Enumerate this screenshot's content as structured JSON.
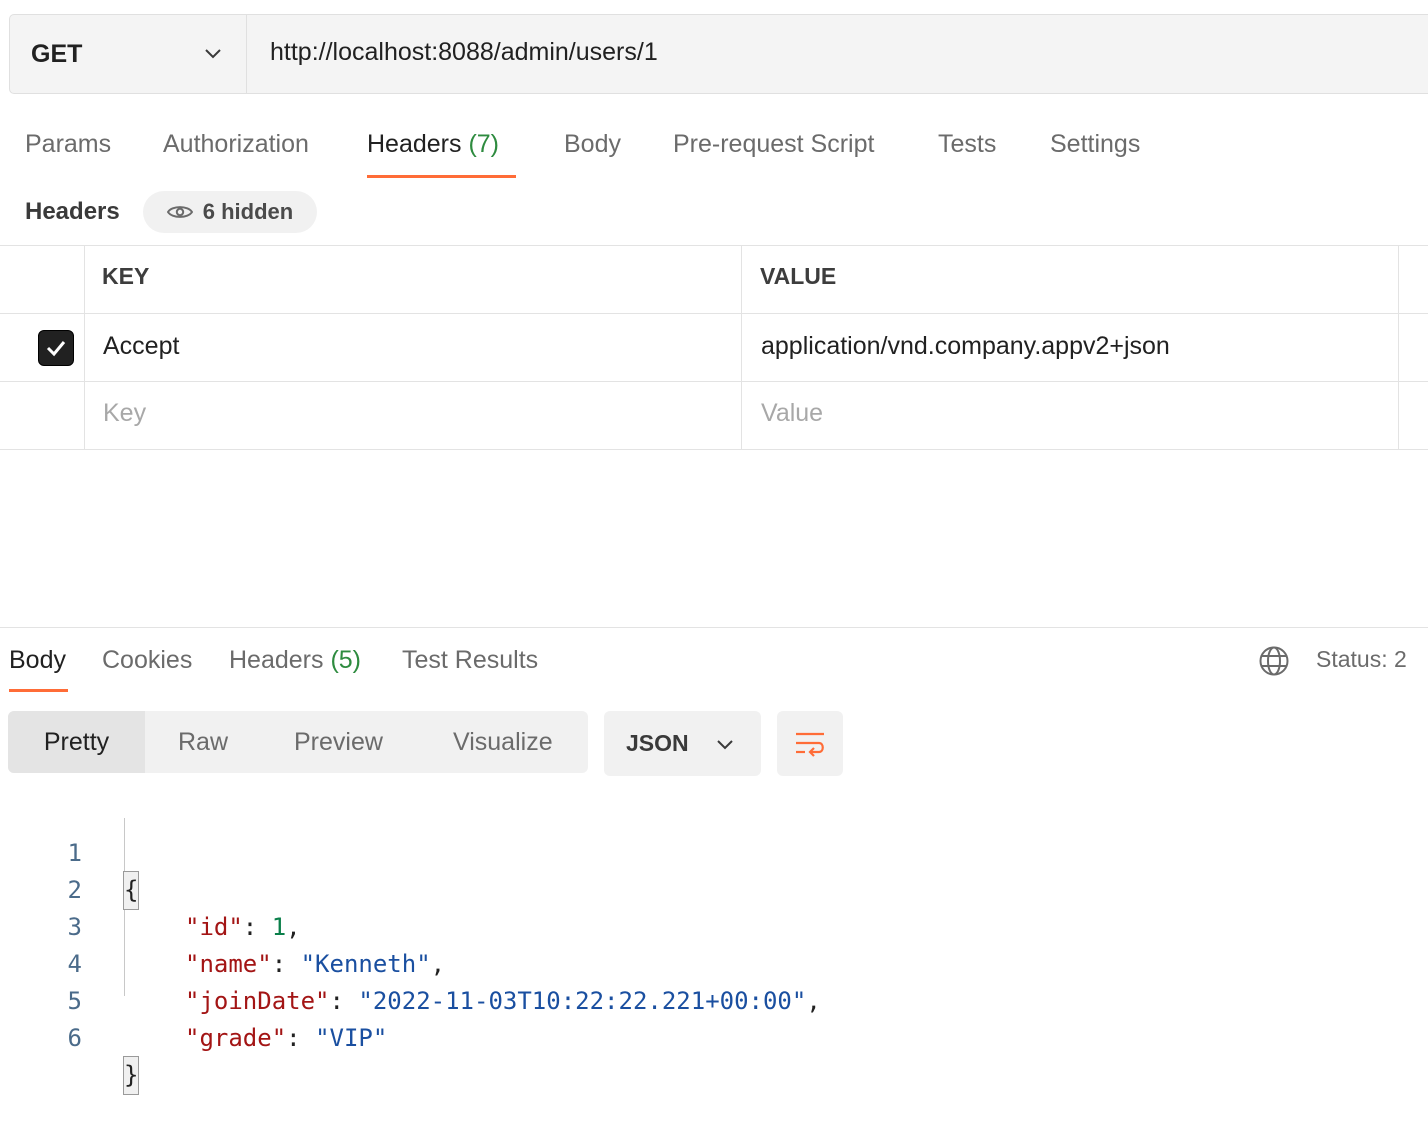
{
  "request": {
    "method": "GET",
    "url": "http://localhost:8088/admin/users/1"
  },
  "request_tabs": [
    {
      "label": "Params",
      "count": ""
    },
    {
      "label": "Authorization",
      "count": ""
    },
    {
      "label": "Headers",
      "count": "(7)"
    },
    {
      "label": "Body",
      "count": ""
    },
    {
      "label": "Pre-request Script",
      "count": ""
    },
    {
      "label": "Tests",
      "count": ""
    },
    {
      "label": "Settings",
      "count": ""
    }
  ],
  "active_request_tab": "Headers",
  "headers_section": {
    "title": "Headers",
    "hidden_label": "6 hidden",
    "columns": {
      "key": "KEY",
      "value": "VALUE"
    },
    "rows": [
      {
        "enabled": true,
        "key": "Accept",
        "value": "application/vnd.company.appv2+json"
      }
    ],
    "new_row": {
      "key_placeholder": "Key",
      "value_placeholder": "Value"
    }
  },
  "response": {
    "tabs": [
      {
        "label": "Body",
        "count": ""
      },
      {
        "label": "Cookies",
        "count": ""
      },
      {
        "label": "Headers",
        "count": "(5)"
      },
      {
        "label": "Test Results",
        "count": ""
      }
    ],
    "active_tab": "Body",
    "status_label": "Status: 2",
    "view_modes": [
      "Pretty",
      "Raw",
      "Preview",
      "Visualize"
    ],
    "active_view_mode": "Pretty",
    "language": "JSON",
    "body_lines": [
      {
        "num": "1",
        "text": "{"
      },
      {
        "num": "2",
        "key": "\"id\"",
        "sep": ": ",
        "value": "1",
        "value_type": "number",
        "trail": ","
      },
      {
        "num": "3",
        "key": "\"name\"",
        "sep": ": ",
        "value": "\"Kenneth\"",
        "value_type": "string",
        "trail": ","
      },
      {
        "num": "4",
        "key": "\"joinDate\"",
        "sep": ": ",
        "value": "\"2022-11-03T10:22:22.221+00:00\"",
        "value_type": "string",
        "trail": ","
      },
      {
        "num": "5",
        "key": "\"grade\"",
        "sep": ": ",
        "value": "\"VIP\"",
        "value_type": "string",
        "trail": ""
      },
      {
        "num": "6",
        "text": "}"
      }
    ]
  },
  "colors": {
    "accent": "#ff6c37",
    "count_green": "#2e8b3f",
    "json_key": "#a31515",
    "json_string": "#1a4fa0",
    "json_number": "#0a7f4a"
  }
}
